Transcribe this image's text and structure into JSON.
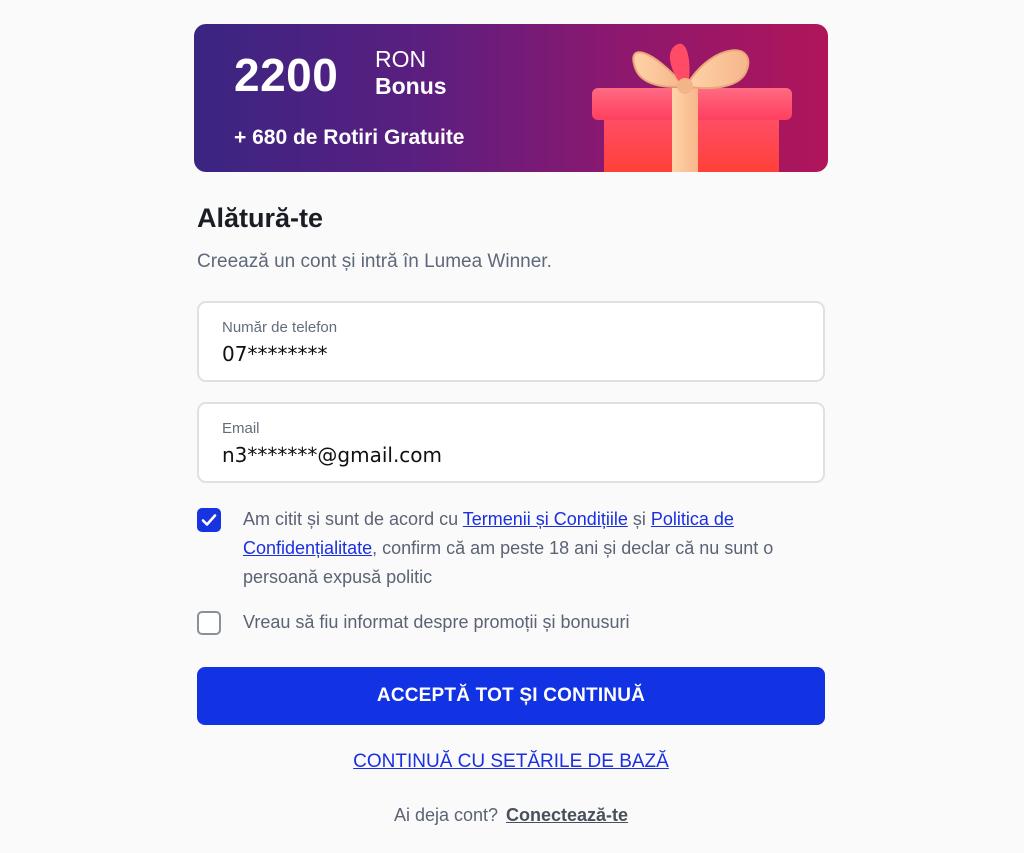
{
  "banner": {
    "amount": "2200",
    "currency": "RON",
    "bonus_word": "Bonus",
    "spins": "+ 680 de Rotiri Gratuite",
    "gift_icon": "gift-box-icon"
  },
  "header": {
    "title": "Alătură-te",
    "subtitle": "Creează un cont și intră în Lumea Winner."
  },
  "form": {
    "phone": {
      "label": "Număr de telefon",
      "value": "07********"
    },
    "email": {
      "label": "Email",
      "value": "n3*******@gmail.com"
    }
  },
  "consents": {
    "terms": {
      "checked": true,
      "text_before": "Am citit și sunt de acord cu ",
      "terms_link": "Termenii și Condițiile",
      "text_mid": " și ",
      "privacy_link": "Politica de Confidențialitate",
      "text_after": ", confirm că am peste 18 ani și declar că nu sunt o persoană expusă politic"
    },
    "promo": {
      "checked": false,
      "text": "Vreau să fiu informat despre promoții și bonusuri"
    }
  },
  "actions": {
    "primary_label": "ACCEPTĂ TOT ȘI CONTINUĂ",
    "secondary_label": "CONTINUĂ CU SETĂRILE DE BAZĂ",
    "login_prompt": "Ai deja cont?",
    "login_link": "Conectează-te"
  },
  "colors": {
    "primary": "#1233e3",
    "link": "#1a2fe0",
    "banner_start": "#3a2582",
    "banner_end": "#b0155a"
  }
}
